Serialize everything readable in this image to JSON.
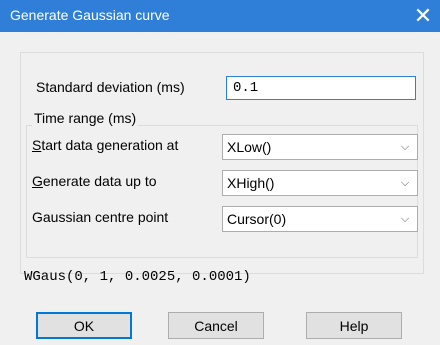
{
  "window": {
    "title": "Generate Gaussian curve",
    "close_glyph": "✕"
  },
  "form": {
    "std_dev_label": "Standard deviation (ms)",
    "std_dev_value": "0.1",
    "time_range_caption": "Time range (ms)",
    "start_label_mnemonic": "S",
    "start_label_rest": "tart data generation at",
    "start_value": "XLow()",
    "upto_label_mnemonic": "G",
    "upto_label_rest": "enerate data up to",
    "upto_value": "XHigh()",
    "centre_label": "Gaussian centre point",
    "centre_value": "Cursor(0)",
    "chevron_glyph": "⌵"
  },
  "formula": "WGaus(0, 1, 0.0025, 0.0001)",
  "buttons": {
    "ok": "OK",
    "cancel": "Cancel",
    "help": "Help"
  },
  "colors": {
    "titlebar": "#2f7fd8",
    "dialog_background": "#f0f0f0",
    "focus_border": "#2f7fd8"
  }
}
